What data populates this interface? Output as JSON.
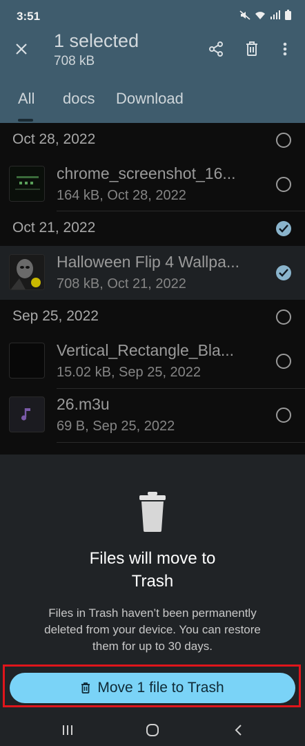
{
  "status_bar": {
    "time": "3:51",
    "icons": [
      "mute-icon",
      "wifi-icon",
      "signal-icon",
      "battery-icon"
    ]
  },
  "header": {
    "title": "1 selected",
    "subtitle": "708 kB"
  },
  "tabs": [
    {
      "label": "All",
      "active": true
    },
    {
      "label": "docs",
      "active": false
    },
    {
      "label": "Download",
      "active": false
    }
  ],
  "groups": [
    {
      "date": "Oct 28, 2022",
      "selected": false,
      "files": [
        {
          "name": "chrome_screenshot_16...",
          "meta": "164 kB, Oct 28, 2022",
          "selected": false,
          "thumb": "screenshot"
        }
      ]
    },
    {
      "date": "Oct 21, 2022",
      "selected": true,
      "files": [
        {
          "name": "Halloween Flip 4 Wallpa...",
          "meta": "708 kB, Oct 21, 2022",
          "selected": true,
          "thumb": "wallpaper"
        }
      ]
    },
    {
      "date": "Sep 25, 2022",
      "selected": false,
      "files": [
        {
          "name": "Vertical_Rectangle_Bla...",
          "meta": "15.02 kB, Sep 25, 2022",
          "selected": false,
          "thumb": "black"
        },
        {
          "name": "26.m3u",
          "meta": "69 B, Sep 25, 2022",
          "selected": false,
          "thumb": "music"
        }
      ]
    }
  ],
  "sheet": {
    "title_line1": "Files will move to",
    "title_line2": "Trash",
    "body_line1": "Files in Trash haven’t been permanently",
    "body_line2": "deleted from your device. You can restore",
    "body_line3": "them for up to 30 days.",
    "button_label": "Move 1 file to Trash"
  },
  "colors": {
    "accent": "#7ad3f7",
    "highlight": "#e0151b",
    "check": "#8ab4cc"
  }
}
